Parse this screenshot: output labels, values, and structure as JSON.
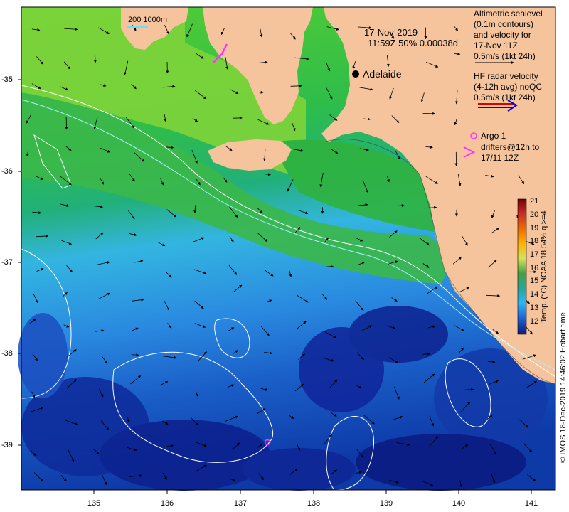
{
  "header": {
    "date": "17-Nov-2019",
    "time_line": "11:59Z  50% 0.00038d"
  },
  "scale_label": "200  1000m",
  "place": {
    "name": "Adelaide"
  },
  "legend": {
    "altimetric": [
      "Altimetric sealevel",
      "(0.1m contours)",
      "and velocity for",
      "17-Nov 11Z",
      "0.5m/s (1kt 24h)"
    ],
    "hf_radar": [
      "HF radar velocity",
      "(4-12h avg) noQC",
      "0.5m/s (1kt 24h)"
    ],
    "argo": "Argo 1",
    "drifters": [
      "drifters@12h to",
      "17/11 12Z"
    ]
  },
  "x_ticks": [
    "135",
    "136",
    "137",
    "138",
    "139",
    "140",
    "141"
  ],
  "y_ticks": [
    "-35",
    "-36",
    "-37",
    "-38",
    "-39"
  ],
  "colorbar": {
    "ticks": [
      "21",
      "20",
      "19",
      "18",
      "17",
      "16",
      "15",
      "14",
      "13",
      "12"
    ],
    "title": "Temp. (°C) NOAA 18 54% ql>=4",
    "colors": [
      "#8b0000",
      "#b22222",
      "#e64a19",
      "#ff9800",
      "#ffc107",
      "#cddc39",
      "#4caf50",
      "#26a69a",
      "#29b6f6",
      "#1e88e5",
      "#283593",
      "#0d1a6b"
    ]
  },
  "credit": "© IMOS 18-Dec-2019 14:46:02 Hobart time",
  "colors": {
    "land": "#f5c49c",
    "ocean_warm": "#3fbf3f",
    "ocean_mid": "#33b5e0",
    "ocean_cool": "#1a5fc8",
    "ocean_cold": "#0a1f8a",
    "argo": "#ff33ff",
    "hf_red": "#e00000",
    "hf_blue": "#0000e0"
  }
}
